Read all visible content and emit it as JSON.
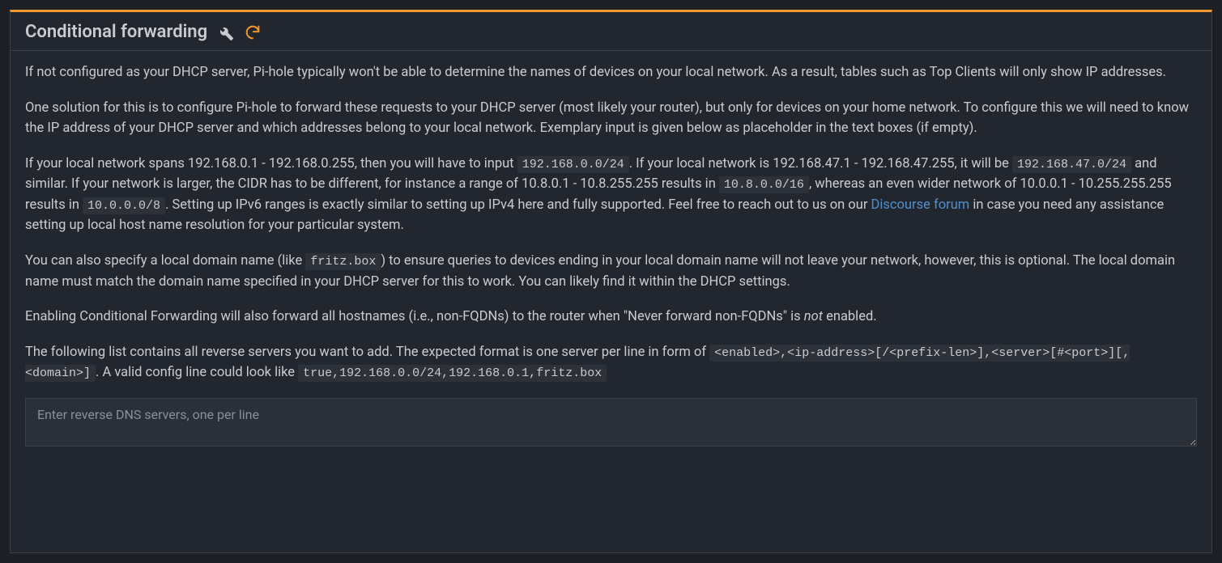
{
  "panel": {
    "title": "Conditional forwarding",
    "icons": {
      "wrench": "wrench-icon",
      "refresh": "refresh-icon"
    }
  },
  "body": {
    "p1": "If not configured as your DHCP server, Pi-hole typically won't be able to determine the names of devices on your local network. As a result, tables such as Top Clients will only show IP addresses.",
    "p2": "One solution for this is to configure Pi-hole to forward these requests to your DHCP server (most likely your router), but only for devices on your home network. To configure this we will need to know the IP address of your DHCP server and which addresses belong to your local network. Exemplary input is given below as placeholder in the text boxes (if empty).",
    "p3": {
      "t1": "If your local network spans 192.168.0.1 - 192.168.0.255, then you will have to input ",
      "c1": "192.168.0.0/24",
      "t2": ". If your local network is 192.168.47.1 - 192.168.47.255, it will be ",
      "c2": "192.168.47.0/24",
      "t3": " and similar. If your network is larger, the CIDR has to be different, for instance a range of 10.8.0.1 - 10.8.255.255 results in ",
      "c3": "10.8.0.0/16",
      "t4": ", whereas an even wider network of 10.0.0.1 - 10.255.255.255 results in ",
      "c4": "10.0.0.0/8",
      "t5": ". Setting up IPv6 ranges is exactly similar to setting up IPv4 here and fully supported. Feel free to reach out to us on our ",
      "link": "Discourse forum",
      "t6": " in case you need any assistance setting up local host name resolution for your particular system."
    },
    "p4": {
      "t1": "You can also specify a local domain name (like ",
      "c1": "fritz.box",
      "t2": ") to ensure queries to devices ending in your local domain name will not leave your network, however, this is optional. The local domain name must match the domain name specified in your DHCP server for this to work. You can likely find it within the DHCP settings."
    },
    "p5": {
      "t1": "Enabling Conditional Forwarding will also forward all hostnames (i.e., non-FQDNs) to the router when \"Never forward non-FQDNs\" is ",
      "em": "not",
      "t2": " enabled."
    },
    "p6": {
      "t1": "The following list contains all reverse servers you want to add. The expected format is one server per line in form of ",
      "c1": "<enabled>,<ip-address>[/<prefix-len>],<server>[#<port>][,<domain>]",
      "t2": ". A valid config line could look like ",
      "c2": "true,192.168.0.0/24,192.168.0.1,fritz.box"
    }
  },
  "textarea": {
    "placeholder": "Enter reverse DNS servers, one per line",
    "value": ""
  }
}
